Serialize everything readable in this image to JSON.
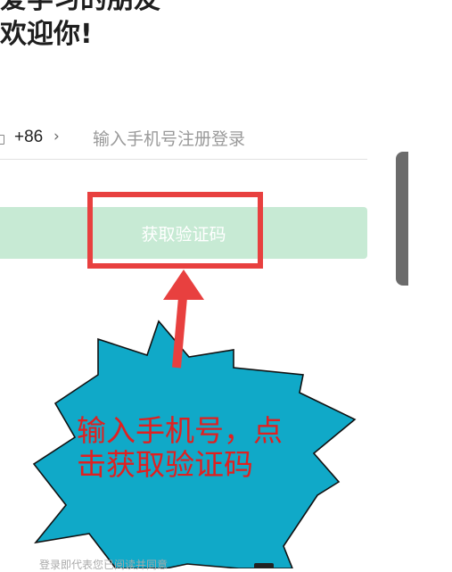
{
  "greeting": {
    "line1": "爱学习的朋友",
    "line2": "欢迎你!"
  },
  "phone": {
    "country_code": "+86",
    "chevron": "›",
    "placeholder": "输入手机号注册登录",
    "value": ""
  },
  "get_code_button": {
    "label": "获取验证码"
  },
  "annotation": {
    "line1": "输入手机号，点",
    "line2": "击获取验证码"
  },
  "agreement": {
    "text": "登录即代表您已阅读并同意"
  },
  "colors": {
    "button_bg": "#c7ead4",
    "highlight": "#e8403f",
    "burst_fill": "#10a9c8",
    "annotation_text": "#e02020"
  },
  "icons": {
    "country_checkbox": "square-outline-icon",
    "arrow": "arrow-up-icon",
    "bottom": "app-icon"
  }
}
